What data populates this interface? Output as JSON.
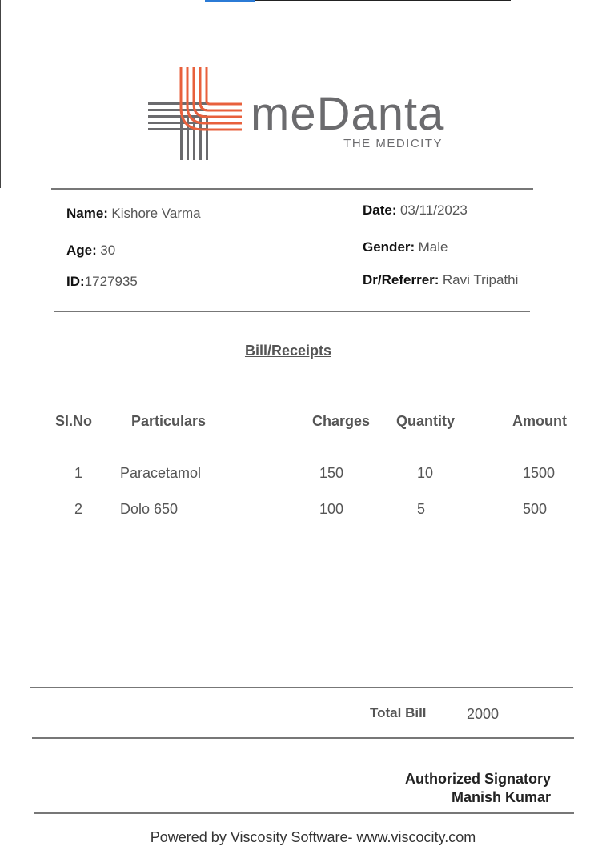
{
  "brand": {
    "name": "meDanta",
    "tagline": "THE MEDICITY",
    "colors": {
      "accent": "#e8603c",
      "gray": "#6b6b6e"
    }
  },
  "patient": {
    "name_label": "Name:",
    "name_value": "Kishore Varma",
    "age_label": "Age:",
    "age_value": "30",
    "id_label": "ID:",
    "id_value": "1727935",
    "date_label": "Date:",
    "date_value": "03/11/2023",
    "gender_label": "Gender:",
    "gender_value": "Male",
    "referrer_label": "Dr/Referrer:",
    "referrer_value": "Ravi Tripathi"
  },
  "bill": {
    "title": "Bill/Receipts",
    "headers": {
      "slno": "Sl.No",
      "particulars": "Particulars",
      "charges": "Charges",
      "quantity": "Quantity",
      "amount": "Amount"
    },
    "rows": [
      {
        "slno": "1",
        "particulars": "Paracetamol",
        "charges": "150",
        "quantity": "10",
        "amount": "1500"
      },
      {
        "slno": "2",
        "particulars": "Dolo 650",
        "charges": "100",
        "quantity": "5",
        "amount": "500"
      }
    ],
    "total_label": "Total Bill",
    "total_value": "2000"
  },
  "signatory": {
    "title": "Authorized Signatory",
    "name": "Manish Kumar"
  },
  "footer": {
    "text": "Powered by Viscosity Software- www.viscocity.com"
  }
}
